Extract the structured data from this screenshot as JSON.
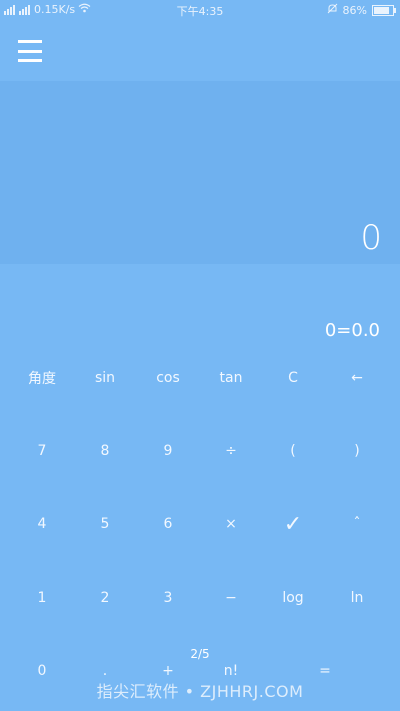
{
  "status_bar": {
    "network_speed": "0.15K/s",
    "time": "下午4:35",
    "battery": "86%",
    "battery_level": 0.86
  },
  "display": {
    "result": "0",
    "expression": "0=0.0"
  },
  "keypad": {
    "row1": [
      "角度",
      "sin",
      "cos",
      "tan",
      "C",
      "←"
    ],
    "row2": [
      "7",
      "8",
      "9",
      "÷",
      "(",
      ")"
    ],
    "row3": [
      "4",
      "5",
      "6",
      "×",
      "✓",
      "ˆ"
    ],
    "row4": [
      "1",
      "2",
      "3",
      "−",
      "log",
      "ln"
    ],
    "row5": [
      "0",
      ".",
      "+",
      "n!",
      "="
    ]
  },
  "page_indicator": "2/5",
  "watermark": "指尖汇软件 • ZJHHRJ.COM"
}
